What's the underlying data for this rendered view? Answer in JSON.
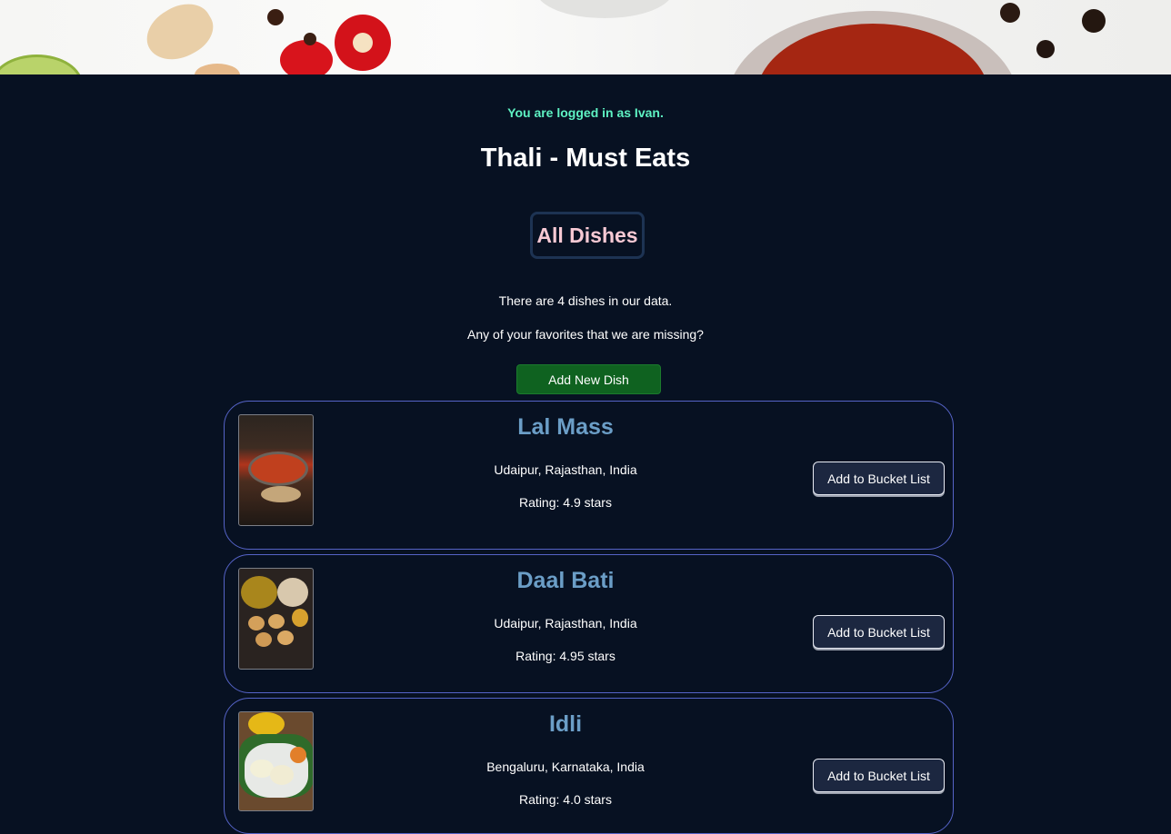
{
  "session": {
    "login_status": "You are logged in as Ivan."
  },
  "page": {
    "title": "Thali - Must Eats"
  },
  "section": {
    "heading": "All Dishes",
    "count_text": "There are 4 dishes in our data.",
    "missing_text": "Any of your favorites that we are missing?",
    "add_button_label": "Add New Dish"
  },
  "dishes": [
    {
      "name": "Lal Mass",
      "location": "Udaipur, Rajasthan, India",
      "rating": "Rating: 4.9 stars",
      "bucket_label": "Add to Bucket List"
    },
    {
      "name": "Daal Bati",
      "location": "Udaipur, Rajasthan, India",
      "rating": "Rating: 4.95 stars",
      "bucket_label": "Add to Bucket List"
    },
    {
      "name": "Idli",
      "location": "Bengaluru, Karnataka, India",
      "rating": "Rating: 4.0 stars",
      "bucket_label": "Add to Bucket List"
    }
  ],
  "colors": {
    "background": "#071122",
    "login_status": "#5ef2c3",
    "section_heading": "#f7c9d4",
    "dish_name": "#6b9ec7",
    "add_button": "#0f6220",
    "card_border": "#5563c7"
  }
}
